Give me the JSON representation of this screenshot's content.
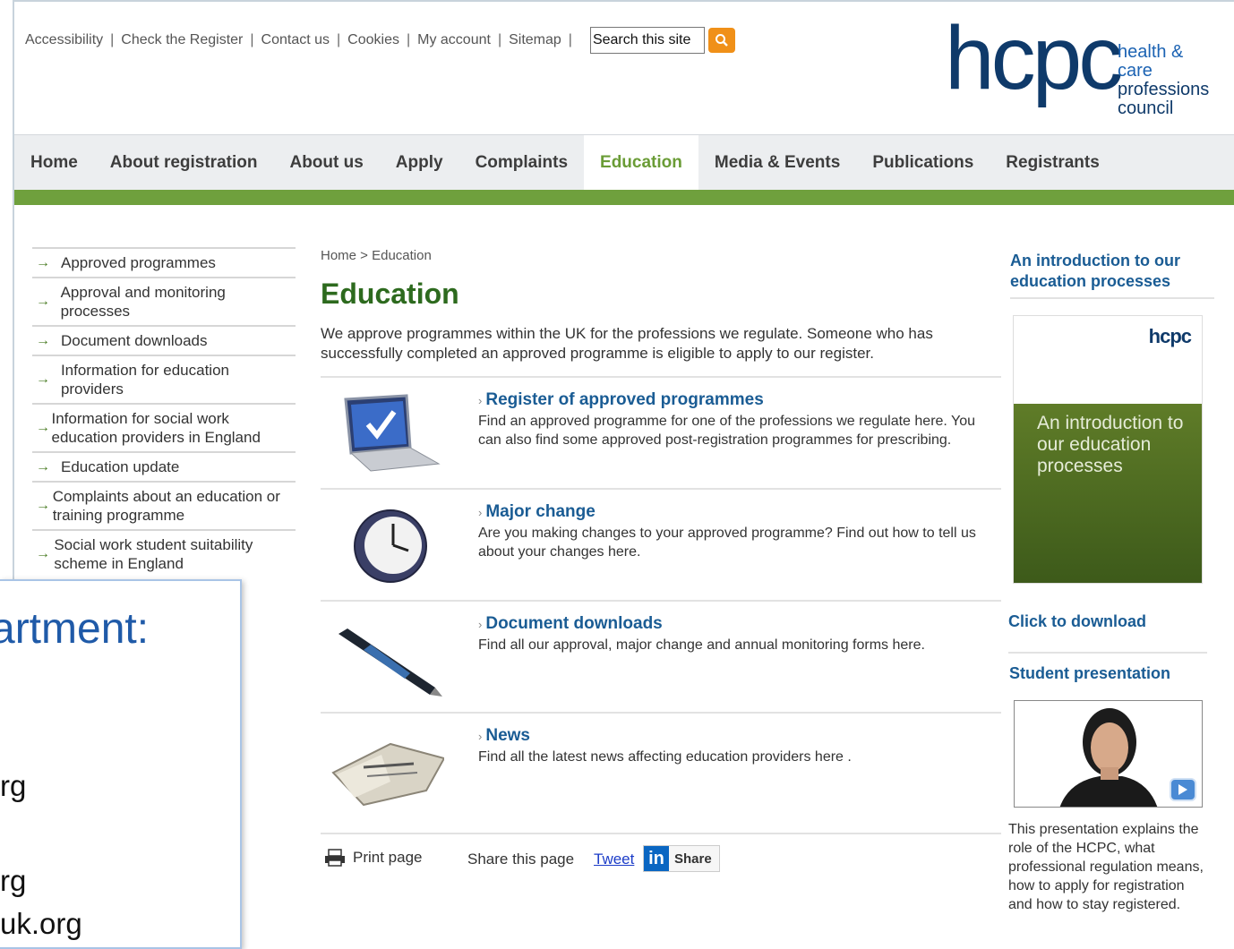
{
  "utility_links": [
    "Accessibility",
    "Check the Register",
    "Contact us",
    "Cookies",
    "My account",
    "Sitemap"
  ],
  "search": {
    "value": "Search this site"
  },
  "logo": {
    "word": "hcpc",
    "tag_line1": "health & care",
    "tag_line2": "professions",
    "tag_line3": "council"
  },
  "nav": {
    "items": [
      "Home",
      "About registration",
      "About us",
      "Apply",
      "Complaints",
      "Education",
      "Media & Events",
      "Publications",
      "Registrants"
    ],
    "active": "Education"
  },
  "sidebar": {
    "items": [
      "Approved programmes",
      "Approval and monitoring processes",
      "Document downloads",
      "Information for education providers",
      "Information for social work education providers in England",
      "Education update",
      "Complaints about an education or training programme",
      "Social work student suitability scheme in England"
    ]
  },
  "breadcrumb": "Home > Education",
  "main": {
    "title": "Education",
    "intro": "We approve programmes within the UK for the professions we regulate. Someone who has successfully completed an approved programme is eligible to apply to our register.",
    "sections": [
      {
        "heading": "Register of approved programmes",
        "description": "Find an approved programme for one of the professions we regulate here. You can also find some approved post-registration programmes for prescribing.",
        "icon": "laptop-checkmark-icon"
      },
      {
        "heading": "Major change",
        "description": "Are you making changes to your approved programme? Find out how to tell us about your changes here.",
        "icon": "clock-icon"
      },
      {
        "heading": "Document downloads",
        "description": "Find all our approval, major change and annual monitoring forms here.",
        "icon": "pen-icon"
      },
      {
        "heading": "News",
        "description": "Find all the latest news affecting education providers here .",
        "icon": "newspaper-icon"
      }
    ]
  },
  "share": {
    "print": "Print page",
    "label": "Share this page",
    "tweet": "Tweet",
    "linkedin": "Share"
  },
  "right": {
    "title": "An introduction to our education processes",
    "brochure_logo": "hcpc",
    "brochure_title": "An introduction to our education processes",
    "download": "Click to download",
    "student": "Student presentation",
    "video_desc": "This presentation explains the role of the HCPC, what professional regulation means, how to apply for registration and how to stay registered."
  },
  "overlay": {
    "title": "artment:",
    "lines": [
      "rg",
      "rg",
      "uk.org"
    ]
  },
  "colors": {
    "accent_green": "#6fa03d",
    "link_blue": "#1a5c94",
    "logo_navy": "#0f3a6a"
  }
}
